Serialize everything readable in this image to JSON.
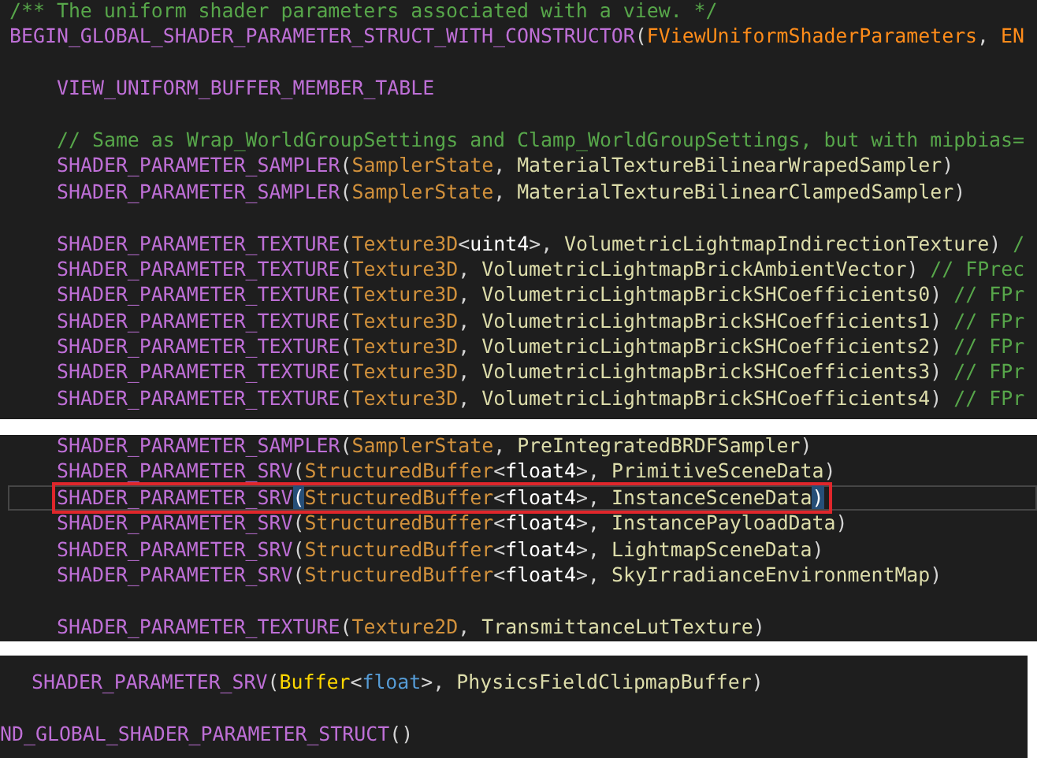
{
  "panels": [
    {
      "lines": [
        {
          "kind": "toplevel",
          "tokens": [
            {
              "kind": "comment",
              "text": "/** The uniform shader parameters associated with a view. */"
            }
          ]
        },
        {
          "kind": "toplevel",
          "tokens": [
            {
              "kind": "macro",
              "text": "BEGIN_GLOBAL_SHADER_PARAMETER_STRUCT_WITH_CONSTRUCTOR"
            },
            {
              "kind": "punct",
              "text": "("
            },
            {
              "kind": "class",
              "text": "FViewUniformShaderParameters"
            },
            {
              "kind": "punct",
              "text": ", "
            },
            {
              "kind": "class",
              "text": "EN"
            }
          ]
        },
        {
          "kind": "blank"
        },
        {
          "kind": "member",
          "tokens": [
            {
              "kind": "macro",
              "text": "VIEW_UNIFORM_BUFFER_MEMBER_TABLE"
            }
          ]
        },
        {
          "kind": "blank"
        },
        {
          "kind": "member",
          "tokens": [
            {
              "kind": "comment",
              "text": "// Same as Wrap_WorldGroupSettings and Clamp_WorldGroupSettings, but with mipbias="
            }
          ]
        },
        {
          "kind": "member",
          "tokens": [
            {
              "kind": "macro",
              "text": "SHADER_PARAMETER_SAMPLER"
            },
            {
              "kind": "punct",
              "text": "("
            },
            {
              "kind": "type",
              "text": "SamplerState"
            },
            {
              "kind": "punct",
              "text": ", "
            },
            {
              "kind": "ident",
              "text": "MaterialTextureBilinearWrapedSampler"
            },
            {
              "kind": "punct",
              "text": ")"
            }
          ]
        },
        {
          "kind": "member",
          "tokens": [
            {
              "kind": "macro",
              "text": "SHADER_PARAMETER_SAMPLER"
            },
            {
              "kind": "punct",
              "text": "("
            },
            {
              "kind": "type",
              "text": "SamplerState"
            },
            {
              "kind": "punct",
              "text": ", "
            },
            {
              "kind": "ident",
              "text": "MaterialTextureBilinearClampedSampler"
            },
            {
              "kind": "punct",
              "text": ")"
            }
          ]
        },
        {
          "kind": "blank"
        },
        {
          "kind": "member",
          "tokens": [
            {
              "kind": "macro",
              "text": "SHADER_PARAMETER_TEXTURE"
            },
            {
              "kind": "punct",
              "text": "("
            },
            {
              "kind": "type",
              "text": "Texture3D"
            },
            {
              "kind": "punct",
              "text": "<"
            },
            {
              "kind": "keyword",
              "text": "uint4"
            },
            {
              "kind": "punct",
              "text": ">, "
            },
            {
              "kind": "ident",
              "text": "VolumetricLightmapIndirectionTexture"
            },
            {
              "kind": "punct",
              "text": ") "
            },
            {
              "kind": "comment",
              "text": "/"
            }
          ]
        },
        {
          "kind": "member",
          "tokens": [
            {
              "kind": "macro",
              "text": "SHADER_PARAMETER_TEXTURE"
            },
            {
              "kind": "punct",
              "text": "("
            },
            {
              "kind": "type",
              "text": "Texture3D"
            },
            {
              "kind": "punct",
              "text": ", "
            },
            {
              "kind": "ident",
              "text": "VolumetricLightmapBrickAmbientVector"
            },
            {
              "kind": "punct",
              "text": ") "
            },
            {
              "kind": "comment",
              "text": "// FPrec"
            }
          ]
        },
        {
          "kind": "member",
          "tokens": [
            {
              "kind": "macro",
              "text": "SHADER_PARAMETER_TEXTURE"
            },
            {
              "kind": "punct",
              "text": "("
            },
            {
              "kind": "type",
              "text": "Texture3D"
            },
            {
              "kind": "punct",
              "text": ", "
            },
            {
              "kind": "ident",
              "text": "VolumetricLightmapBrickSHCoefficients0"
            },
            {
              "kind": "punct",
              "text": ") "
            },
            {
              "kind": "comment",
              "text": "// FPr"
            }
          ]
        },
        {
          "kind": "member",
          "tokens": [
            {
              "kind": "macro",
              "text": "SHADER_PARAMETER_TEXTURE"
            },
            {
              "kind": "punct",
              "text": "("
            },
            {
              "kind": "type",
              "text": "Texture3D"
            },
            {
              "kind": "punct",
              "text": ", "
            },
            {
              "kind": "ident",
              "text": "VolumetricLightmapBrickSHCoefficients1"
            },
            {
              "kind": "punct",
              "text": ") "
            },
            {
              "kind": "comment",
              "text": "// FPr"
            }
          ]
        },
        {
          "kind": "member",
          "tokens": [
            {
              "kind": "macro",
              "text": "SHADER_PARAMETER_TEXTURE"
            },
            {
              "kind": "punct",
              "text": "("
            },
            {
              "kind": "type",
              "text": "Texture3D"
            },
            {
              "kind": "punct",
              "text": ", "
            },
            {
              "kind": "ident",
              "text": "VolumetricLightmapBrickSHCoefficients2"
            },
            {
              "kind": "punct",
              "text": ") "
            },
            {
              "kind": "comment",
              "text": "// FPr"
            }
          ]
        },
        {
          "kind": "member",
          "tokens": [
            {
              "kind": "macro",
              "text": "SHADER_PARAMETER_TEXTURE"
            },
            {
              "kind": "punct",
              "text": "("
            },
            {
              "kind": "type",
              "text": "Texture3D"
            },
            {
              "kind": "punct",
              "text": ", "
            },
            {
              "kind": "ident",
              "text": "VolumetricLightmapBrickSHCoefficients3"
            },
            {
              "kind": "punct",
              "text": ") "
            },
            {
              "kind": "comment",
              "text": "// FPr"
            }
          ]
        },
        {
          "kind": "member",
          "tokens": [
            {
              "kind": "macro",
              "text": "SHADER_PARAMETER_TEXTURE"
            },
            {
              "kind": "punct",
              "text": "("
            },
            {
              "kind": "type",
              "text": "Texture3D"
            },
            {
              "kind": "punct",
              "text": ", "
            },
            {
              "kind": "ident",
              "text": "VolumetricLightmapBrickSHCoefficients4"
            },
            {
              "kind": "punct",
              "text": ") "
            },
            {
              "kind": "comment",
              "text": "// FPr"
            }
          ]
        }
      ]
    },
    {
      "lines": [
        {
          "kind": "member",
          "highlighted": false,
          "tokens": [
            {
              "kind": "macro",
              "text": "SHADER_PARAMETER_SAMPLER"
            },
            {
              "kind": "punct",
              "text": "("
            },
            {
              "kind": "type",
              "text": "SamplerState"
            },
            {
              "kind": "punct",
              "text": ", "
            },
            {
              "kind": "ident",
              "text": "PreIntegratedBRDFSampler"
            },
            {
              "kind": "punct",
              "text": ")"
            }
          ]
        },
        {
          "kind": "member",
          "highlighted": false,
          "tokens": [
            {
              "kind": "macro",
              "text": "SHADER_PARAMETER_SRV"
            },
            {
              "kind": "punct",
              "text": "("
            },
            {
              "kind": "type",
              "text": "StructuredBuffer"
            },
            {
              "kind": "punct",
              "text": "<"
            },
            {
              "kind": "keyword",
              "text": "float4"
            },
            {
              "kind": "punct",
              "text": ">, "
            },
            {
              "kind": "ident",
              "text": "PrimitiveSceneData"
            },
            {
              "kind": "punct",
              "text": ")"
            }
          ]
        },
        {
          "kind": "member",
          "highlighted": true,
          "tokens": [
            {
              "kind": "macro",
              "text": "SHADER_PARAMETER_SRV"
            },
            {
              "kind": "bracket",
              "text": "("
            },
            {
              "kind": "type",
              "text": "StructuredBuffer"
            },
            {
              "kind": "punct",
              "text": "<"
            },
            {
              "kind": "keyword",
              "text": "float4"
            },
            {
              "kind": "punct",
              "text": ">, "
            },
            {
              "kind": "ident",
              "text": "InstanceSceneData"
            },
            {
              "kind": "bracket",
              "text": ")"
            }
          ]
        },
        {
          "kind": "member",
          "highlighted": false,
          "tokens": [
            {
              "kind": "macro",
              "text": "SHADER_PARAMETER_SRV"
            },
            {
              "kind": "punct",
              "text": "("
            },
            {
              "kind": "type",
              "text": "StructuredBuffer"
            },
            {
              "kind": "punct",
              "text": "<"
            },
            {
              "kind": "keyword",
              "text": "float4"
            },
            {
              "kind": "punct",
              "text": ">, "
            },
            {
              "kind": "ident",
              "text": "InstancePayloadData"
            },
            {
              "kind": "punct",
              "text": ")"
            }
          ]
        },
        {
          "kind": "member",
          "highlighted": false,
          "tokens": [
            {
              "kind": "macro",
              "text": "SHADER_PARAMETER_SRV"
            },
            {
              "kind": "punct",
              "text": "("
            },
            {
              "kind": "type",
              "text": "StructuredBuffer"
            },
            {
              "kind": "punct",
              "text": "<"
            },
            {
              "kind": "keyword",
              "text": "float4"
            },
            {
              "kind": "punct",
              "text": ">, "
            },
            {
              "kind": "ident",
              "text": "LightmapSceneData"
            },
            {
              "kind": "punct",
              "text": ")"
            }
          ]
        },
        {
          "kind": "member",
          "highlighted": false,
          "tokens": [
            {
              "kind": "macro",
              "text": "SHADER_PARAMETER_SRV"
            },
            {
              "kind": "punct",
              "text": "("
            },
            {
              "kind": "type",
              "text": "StructuredBuffer"
            },
            {
              "kind": "punct",
              "text": "<"
            },
            {
              "kind": "keyword",
              "text": "float4"
            },
            {
              "kind": "punct",
              "text": ">, "
            },
            {
              "kind": "ident",
              "text": "SkyIrradianceEnvironmentMap"
            },
            {
              "kind": "punct",
              "text": ")"
            }
          ]
        },
        {
          "kind": "blank"
        },
        {
          "kind": "member",
          "highlighted": false,
          "tokens": [
            {
              "kind": "macro",
              "text": "SHADER_PARAMETER_TEXTURE"
            },
            {
              "kind": "punct",
              "text": "("
            },
            {
              "kind": "type",
              "text": "Texture2D"
            },
            {
              "kind": "punct",
              "text": ", "
            },
            {
              "kind": "ident",
              "text": "TransmittanceLutTexture"
            },
            {
              "kind": "punct",
              "text": ")"
            }
          ]
        }
      ]
    },
    {
      "lines": [
        {
          "kind": "member",
          "tokens": [
            {
              "kind": "macro",
              "text": "SHADER_PARAMETER_SRV"
            },
            {
              "kind": "punct",
              "text": "("
            },
            {
              "kind": "class2",
              "text": "Buffer"
            },
            {
              "kind": "punct",
              "text": "<"
            },
            {
              "kind": "builtin",
              "text": "float"
            },
            {
              "kind": "punct",
              "text": ">, "
            },
            {
              "kind": "ident",
              "text": "PhysicsFieldClipmapBuffer"
            },
            {
              "kind": "punct",
              "text": ")"
            }
          ]
        },
        {
          "kind": "blank"
        },
        {
          "kind": "toplevel",
          "tokens": [
            {
              "kind": "macro",
              "text": "ND_GLOBAL_SHADER_PARAMETER_STRUCT"
            },
            {
              "kind": "punct",
              "text": "()"
            }
          ]
        }
      ]
    }
  ]
}
